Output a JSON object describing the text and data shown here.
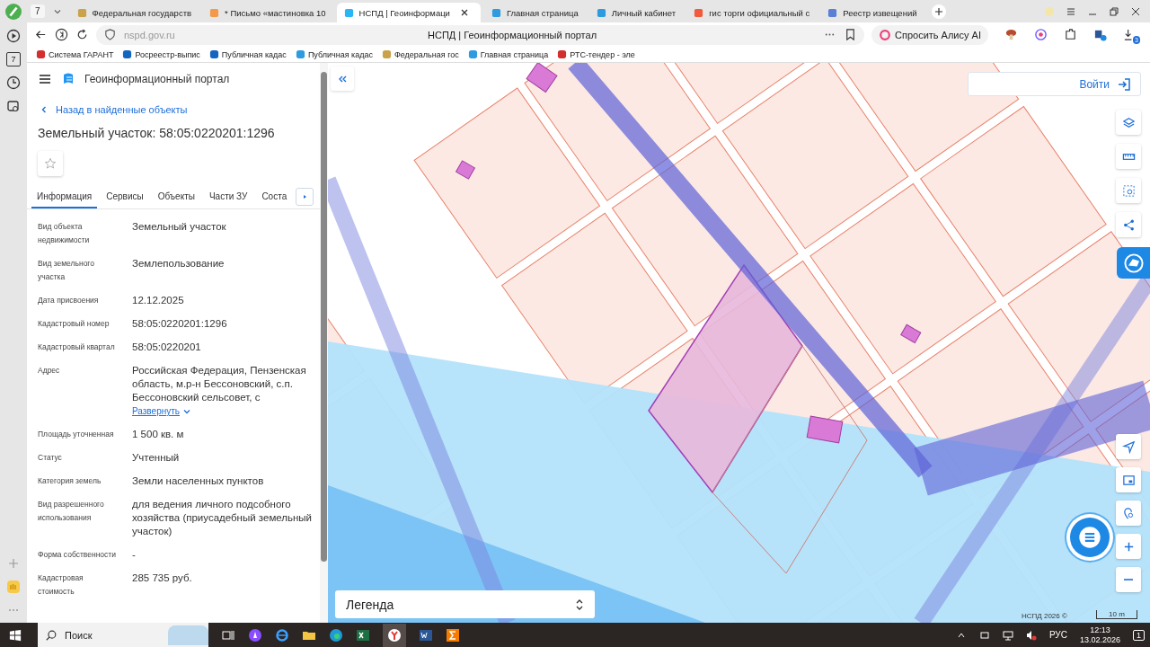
{
  "browser": {
    "sidebar_badge": "7",
    "tab_count": "7",
    "tabs": [
      {
        "title": "Федеральная государств",
        "selected": false
      },
      {
        "title": "* Письмо «мастиновка 10",
        "selected": false
      },
      {
        "title": "НСПД | Геоинформаци",
        "selected": true
      },
      {
        "title": "Главная страница",
        "selected": false
      },
      {
        "title": "Личный кабинет",
        "selected": false
      },
      {
        "title": "гис торги официальный с",
        "selected": false
      },
      {
        "title": "Реестр извещений",
        "selected": false
      }
    ],
    "url": "nspd.gov.ru",
    "page_title": "НСПД | Геоинформационный портал",
    "alice_button": "Спросить Алису AI",
    "downloads_badge": "3",
    "bookmarks": [
      "Система ГАРАНТ",
      "Росреестр-выпис",
      "Публичная кадас",
      "Публичная кадас",
      "Федеральная гос",
      "Главная страница",
      "РТС-тендер - эле"
    ]
  },
  "portal": {
    "title": "Геоинформационный портал",
    "back_link": "Назад в найденные объекты",
    "heading": "Земельный участок: 58:05:0220201:1296",
    "tabs": [
      {
        "label": "Информация",
        "selected": true
      },
      {
        "label": "Сервисы",
        "selected": false
      },
      {
        "label": "Объекты",
        "selected": false
      },
      {
        "label": "Части ЗУ",
        "selected": false
      },
      {
        "label": "Соста",
        "selected": false
      }
    ],
    "fields": [
      {
        "label": "Вид объекта недвижимости",
        "value": "Земельный участок"
      },
      {
        "label": "Вид земельного участка",
        "value": "Землепользование"
      },
      {
        "label": "Дата присвоения",
        "value": "12.12.2025"
      },
      {
        "label": "Кадастровый номер",
        "value": "58:05:0220201:1296"
      },
      {
        "label": "Кадастровый квартал",
        "value": "58:05:0220201"
      },
      {
        "label": "Адрес",
        "value": "Российская Федерация, Пензенская область, м.р-н Бессоновский, с.п. Бессоновский сельсовет, с",
        "expand_link": "Развернуть"
      },
      {
        "label": "Площадь уточненная",
        "value": "1 500 кв. м"
      },
      {
        "label": "Статус",
        "value": "Учтенный"
      },
      {
        "label": "Категория земель",
        "value": "Земли населенных пунктов"
      },
      {
        "label": "Вид разрешенного использования",
        "value": "для ведения личного подсобного хозяйства (приусадебный земельный участок)"
      },
      {
        "label": "Форма собственности",
        "value": "-"
      },
      {
        "label": "Кадастровая стоимость",
        "value": "285 735 руб."
      }
    ]
  },
  "map": {
    "login_button": "Войти",
    "legend": "Легенда",
    "copyright": "НСПД 2026 ©",
    "scale": "10 m"
  },
  "taskbar": {
    "search_placeholder": "Поиск",
    "language": "РУС",
    "time": "12:13",
    "date": "13.02.2026",
    "notifications": "1"
  }
}
